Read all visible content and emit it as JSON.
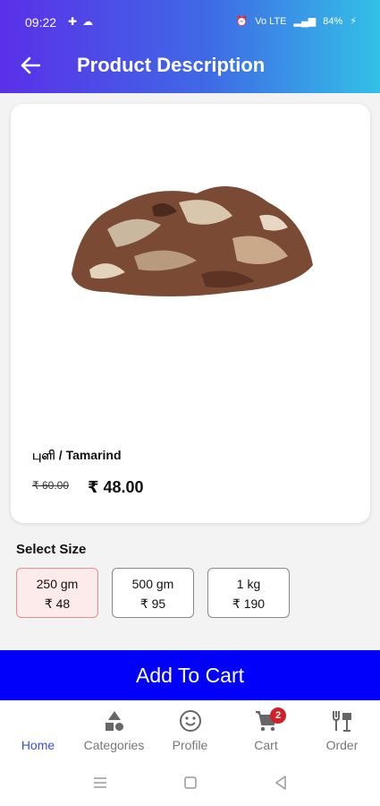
{
  "status_bar": {
    "time": "09:22",
    "battery": "84%",
    "network": "Vo LTE"
  },
  "header": {
    "title": "Product Description"
  },
  "product": {
    "name": "புளி / Tamarind",
    "old_price": "₹ 60.00",
    "price": "₹ 48.00"
  },
  "size_section": {
    "label": "Select Size"
  },
  "sizes": [
    {
      "weight": "250 gm",
      "price": "₹ 48",
      "selected": true
    },
    {
      "weight": "500 gm",
      "price": "₹ 95",
      "selected": false
    },
    {
      "weight": "1 kg",
      "price": "₹ 190",
      "selected": false
    }
  ],
  "cta": {
    "add_to_cart": "Add To Cart"
  },
  "nav": {
    "items": [
      {
        "label": "Home",
        "icon": "home-icon"
      },
      {
        "label": "Categories",
        "icon": "categories-icon"
      },
      {
        "label": "Profile",
        "icon": "smiley-icon"
      },
      {
        "label": "Cart",
        "icon": "cart-icon"
      },
      {
        "label": "Order",
        "icon": "order-icon"
      }
    ],
    "cart_badge": "2"
  },
  "colors": {
    "accent": "#0000fb",
    "nav_active": "#3d4fd8",
    "badge": "#d0202a"
  }
}
